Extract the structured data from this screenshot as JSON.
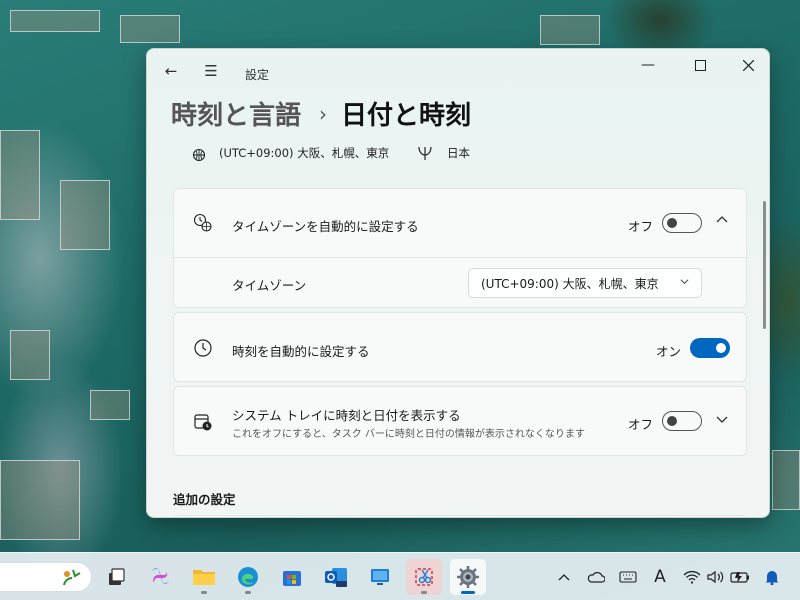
{
  "window": {
    "app_title": "設定",
    "breadcrumb_parent": "時刻と言語",
    "breadcrumb_separator": "›",
    "breadcrumb_current": "日付と時刻"
  },
  "info": {
    "timezone_summary": "(UTC+09:00) 大阪、札幌、東京",
    "region_summary": "日本"
  },
  "cards": {
    "auto_timezone": {
      "label": "タイムゾーンを自動的に設定する",
      "state_label": "オフ",
      "state": "off",
      "timezone_label": "タイムゾーン",
      "timezone_value": "(UTC+09:00) 大阪、札幌、東京"
    },
    "auto_time": {
      "label": "時刻を自動的に設定する",
      "state_label": "オン",
      "state": "on"
    },
    "tray": {
      "label": "システム トレイに時刻と日付を表示する",
      "sublabel": "これをオフにすると、タスク バーに時刻と日付の情報が表示されなくなります",
      "state_label": "オフ",
      "state": "off"
    }
  },
  "section": {
    "additional_settings": "追加の設定"
  },
  "taskbar": {
    "apps": [
      "copilot-icon",
      "file-explorer-icon",
      "edge-icon",
      "store-icon",
      "outlook-icon",
      "remote-desktop-icon",
      "snipping-tool-icon",
      "settings-icon"
    ],
    "ime_label": "A"
  },
  "colors": {
    "accent": "#0067c0"
  }
}
